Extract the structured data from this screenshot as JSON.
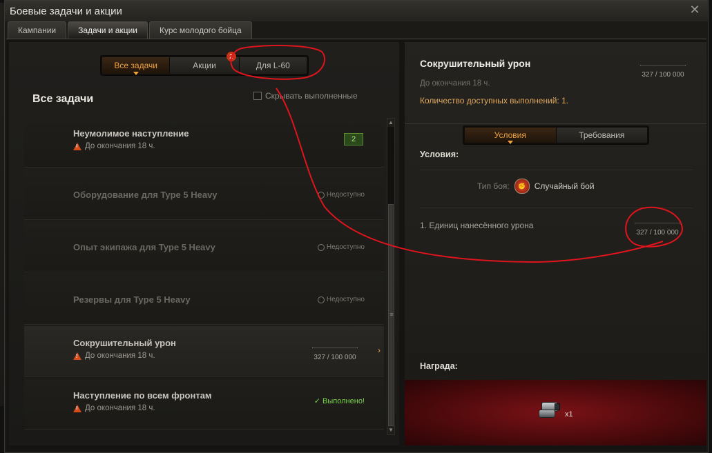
{
  "window": {
    "title": "Боевые задачи и акции",
    "close_label": "✕"
  },
  "tabs": [
    {
      "label": "Кампании",
      "active": false
    },
    {
      "label": "Задачи и акции",
      "active": true
    },
    {
      "label": "Курс молодого бойца",
      "active": false
    }
  ],
  "filter": {
    "buttons": [
      {
        "label": "Все задачи",
        "active": true
      },
      {
        "label": "Акции",
        "active": false,
        "badge": "2"
      },
      {
        "label": "Для L-60",
        "active": false
      }
    ]
  },
  "list": {
    "title": "Все задачи",
    "hide_completed_label": "Скрывать выполненные",
    "items": [
      {
        "name": "Неумолимое наступление",
        "deadline": "До окончания 18 ч.",
        "count": "2"
      },
      {
        "name": "Оборудование для Type 5 Heavy",
        "status": "Недоступно"
      },
      {
        "name": "Опыт экипажа для Type 5 Heavy",
        "status": "Недоступно"
      },
      {
        "name": "Резервы для Type 5 Heavy",
        "status": "Недоступно"
      },
      {
        "name": "Сокрушительный урон",
        "deadline": "До окончания 18 ч.",
        "progress": "327 / 100 000",
        "progress_fraction": 0.00327
      },
      {
        "name": "Наступление по всем фронтам",
        "deadline": "До окончания 18 ч.",
        "status": "✓ Выполнено!"
      }
    ],
    "scroll_up": "▲",
    "scroll_down": "▼",
    "scroll_grip": "≡",
    "row_chevron": "›"
  },
  "detail": {
    "title": "Сокрушительный урон",
    "progress": "327 / 100 000",
    "deadline": "До окончания 18 ч.",
    "available": "Количество доступных выполнений: 1.",
    "tabs": [
      {
        "label": "Условия",
        "active": true
      },
      {
        "label": "Требования",
        "active": false
      }
    ],
    "conditions_title": "Условия:",
    "battle_type_label": "Тип боя:",
    "battle_type_value": "Случайный бой",
    "condition_item": "1. Единиц нанесённого урона",
    "condition_progress": "327 / 100 000",
    "reward_title": "Награда:",
    "reward_qty": "x1"
  },
  "colors": {
    "accent": "#f0a33a",
    "warning": "#d74a1c",
    "success": "#7bd64b",
    "annotation": "#e0141c"
  }
}
